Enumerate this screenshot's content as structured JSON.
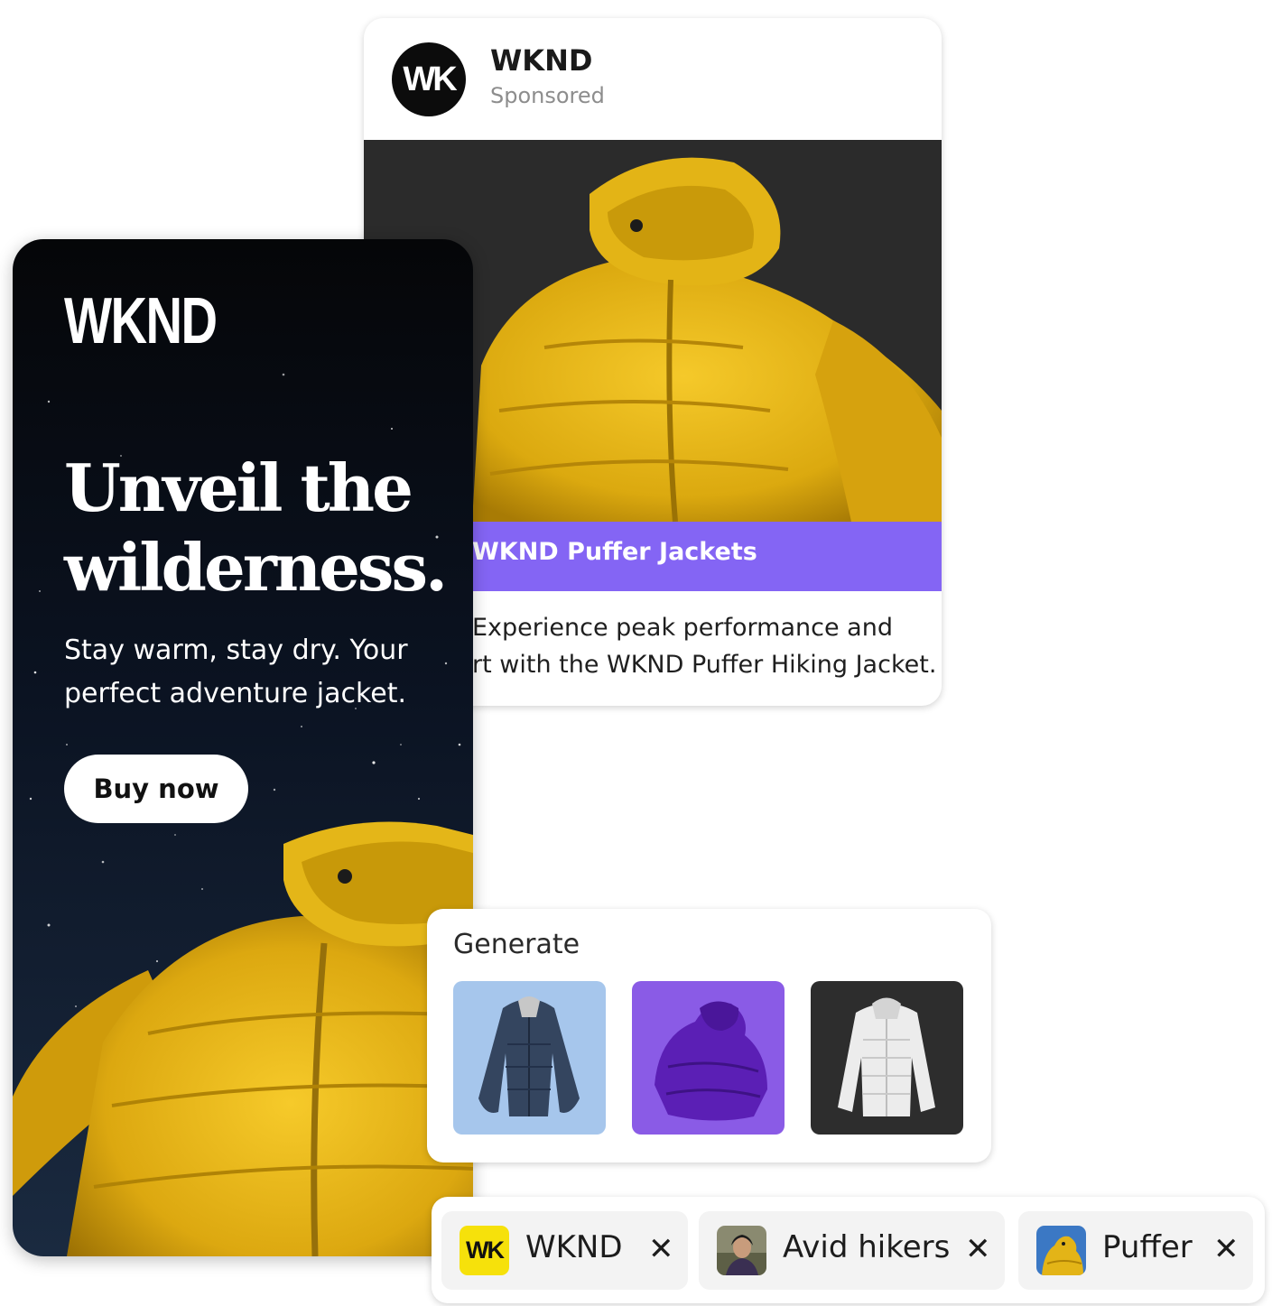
{
  "post": {
    "avatar_text": "WK",
    "brand": "WKND",
    "sponsored": "Sponsored",
    "image_icon": "yellow-puffer-jacket-image",
    "cta": "WKND Puffer Jackets",
    "body_line1": "Experience peak performance and",
    "body_line2": "rt with the WKND Puffer Hiking Jacket.",
    "cta_color": "#8465f4"
  },
  "banner": {
    "logo": "WKND",
    "headline_line1": "Unveil the",
    "headline_line2": "wilderness.",
    "sub_line1": "Stay warm, stay dry. Your",
    "sub_line2": "perfect adventure jacket.",
    "button": "Buy now",
    "image_icon": "yellow-puffer-jacket-image"
  },
  "generate": {
    "title": "Generate",
    "thumbnails": [
      {
        "icon": "navy-parka-image",
        "bg": "#a6c6ec"
      },
      {
        "icon": "purple-puffer-image",
        "bg": "#8a5be6"
      },
      {
        "icon": "white-puffer-image",
        "bg": "#2d2d2d"
      }
    ]
  },
  "tags": [
    {
      "thumb_text": "WK",
      "label": "WKND",
      "close": "✕"
    },
    {
      "thumb_icon": "hiker-portrait-image",
      "label": "Avid hikers",
      "close": "✕"
    },
    {
      "thumb_icon": "yellow-jacket-thumbnail",
      "label": "Puffer",
      "close": "✕"
    }
  ]
}
